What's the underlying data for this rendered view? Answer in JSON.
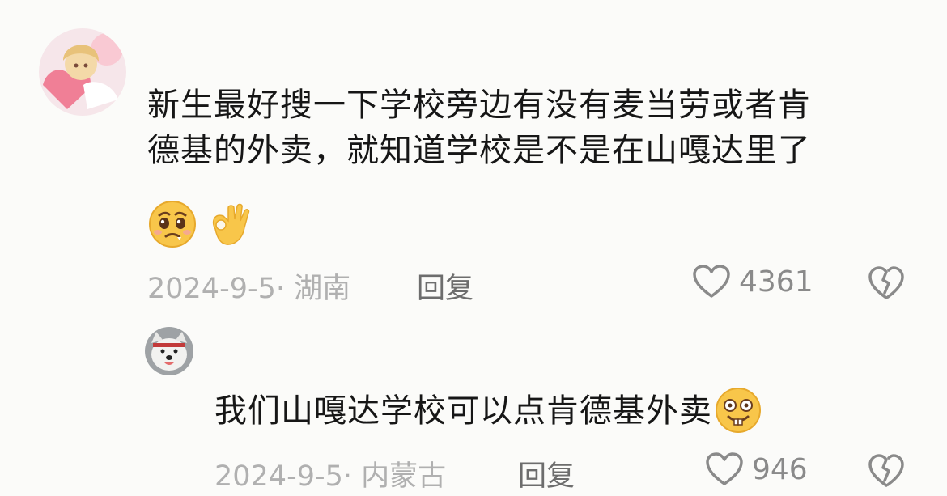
{
  "comment": {
    "text_line1": "新生最好搜一下学校旁边有没有麦当劳或者肯",
    "text_line2": "德基的外卖，就知道学校是不是在山嘎达里了",
    "emojis": [
      "pleading-face-emoji",
      "ok-hand-emoji"
    ],
    "date_location": "2024-9-5· 湖南",
    "reply_label": "回复",
    "like_count": "4361"
  },
  "reply": {
    "text": "我们山嘎达学校可以点肯德基外卖",
    "emoji": "grinning-buckteeth-emoji",
    "date_location": "2024-9-5· 内蒙古",
    "reply_label": "回复",
    "like_count": "946"
  },
  "icons": {
    "like": "heart-outline-icon",
    "dislike": "broken-heart-icon"
  },
  "colors": {
    "background": "#fbfbf9",
    "text": "#161616",
    "meta": "#b0b0b0",
    "reply_label": "#6d6d6d",
    "icon": "#8a8a8a"
  }
}
